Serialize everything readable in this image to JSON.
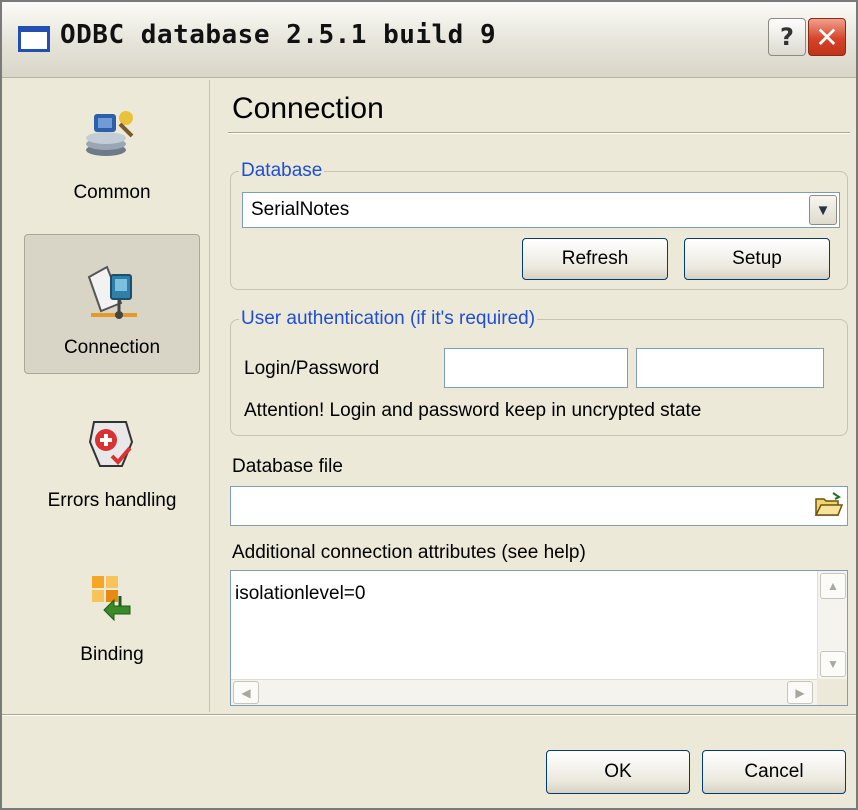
{
  "window": {
    "title": "ODBC database 2.5.1 build 9",
    "help_label": "?",
    "close_label": "✕"
  },
  "sidebar": {
    "items": [
      {
        "label": "Common",
        "icon": "common-icon",
        "selected": false
      },
      {
        "label": "Connection",
        "icon": "connection-icon",
        "selected": true
      },
      {
        "label": "Errors handling",
        "icon": "errors-handling-icon",
        "selected": false
      },
      {
        "label": "Binding",
        "icon": "binding-icon",
        "selected": false
      }
    ]
  },
  "panel": {
    "title": "Connection",
    "database_group": {
      "legend": "Database",
      "selected": "SerialNotes",
      "refresh_label": "Refresh",
      "setup_label": "Setup"
    },
    "auth_group": {
      "legend": "User authentication (if it's required)",
      "login_password_label": "Login/Password",
      "login_value": "",
      "password_value": "",
      "attention": "Attention! Login and password keep in uncrypted state"
    },
    "database_file": {
      "label": "Database file",
      "value": ""
    },
    "attributes": {
      "label": "Additional connection attributes (see help)",
      "value": "isolationlevel=0"
    }
  },
  "footer": {
    "ok_label": "OK",
    "cancel_label": "Cancel"
  },
  "colors": {
    "legend": "#1f4ed1",
    "close_button": "#d6442a",
    "window_bg": "#ece9d8"
  }
}
